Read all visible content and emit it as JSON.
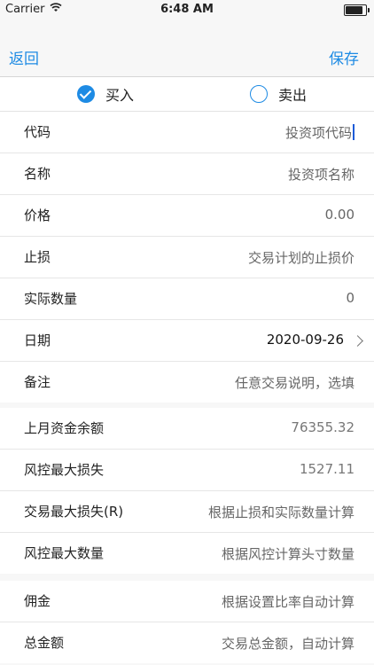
{
  "status": {
    "carrier": "Carrier",
    "time": "6:48 AM"
  },
  "nav": {
    "back": "返回",
    "save": "保存"
  },
  "segment": {
    "buy": "买入",
    "sell": "卖出"
  },
  "form": {
    "code": {
      "label": "代码",
      "placeholder": "投资项代码"
    },
    "name": {
      "label": "名称",
      "placeholder": "投资项名称"
    },
    "price": {
      "label": "价格",
      "value": "0.00"
    },
    "stoploss": {
      "label": "止损",
      "placeholder": "交易计划的止损价"
    },
    "quantity": {
      "label": "实际数量",
      "value": "0"
    },
    "date": {
      "label": "日期",
      "value": "2020-09-26"
    },
    "note": {
      "label": "备注",
      "placeholder": "任意交易说明，选填"
    }
  },
  "risk": {
    "balance": {
      "label": "上月资金余额",
      "value": "76355.32"
    },
    "max_loss": {
      "label": "风控最大损失",
      "value": "1527.11"
    },
    "trade_max_loss": {
      "label": "交易最大损失(R)",
      "value": "根据止损和实际数量计算"
    },
    "max_qty": {
      "label": "风控最大数量",
      "value": "根据风控计算头寸数量"
    }
  },
  "fees": {
    "commission": {
      "label": "佣金",
      "value": "根据设置比率自动计算"
    },
    "total": {
      "label": "总金额",
      "value": "交易总金额，自动计算"
    }
  },
  "colors": {
    "accent": "#1e8be4"
  }
}
